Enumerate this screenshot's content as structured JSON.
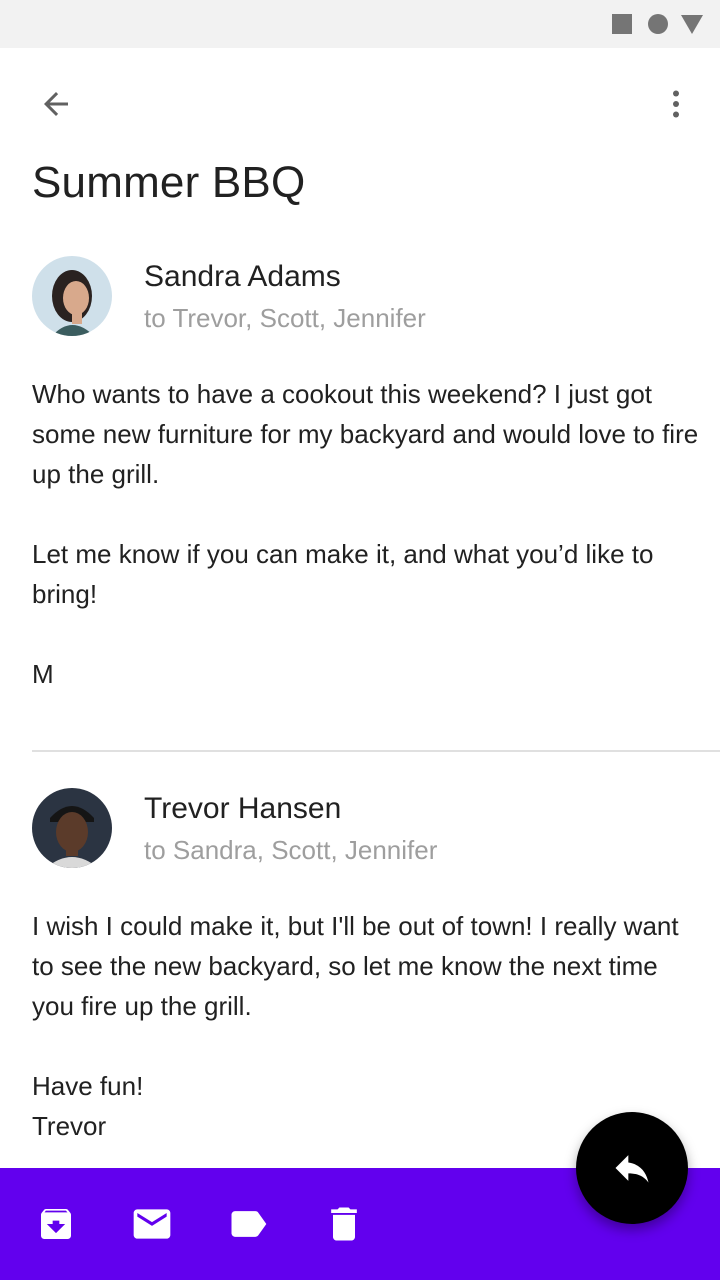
{
  "colors": {
    "status_bar_bg": "#f2f2f2",
    "bottom_bar_bg": "#6200ee",
    "fab_bg": "#000000",
    "secondary_text": "#9e9e9e"
  },
  "app_bar": {
    "back_icon": "arrow-back-icon",
    "overflow_icon": "more-vert-icon"
  },
  "email": {
    "subject": "Summer BBQ",
    "messages": [
      {
        "sender": "Sandra Adams",
        "recipients": "to Trevor, Scott, Jennifer",
        "body": [
          "Who wants to have a cookout this weekend? I just got some new furniture for my backyard and would love to fire up the grill.",
          "Let me know if you can make it, and what you’d like to bring!",
          "M"
        ]
      },
      {
        "sender": "Trevor Hansen",
        "recipients": "to Sandra, Scott, Jennifer",
        "body": [
          "I wish I could make it, but I'll be out of town! I really want to see the new backyard, so let me know the next time you fire up the grill.",
          "Have fun!",
          "Trevor"
        ]
      }
    ]
  },
  "bottom_bar": {
    "actions": [
      "archive-icon",
      "mail-icon",
      "label-icon",
      "delete-icon"
    ]
  },
  "fab": {
    "icon": "reply-icon"
  }
}
